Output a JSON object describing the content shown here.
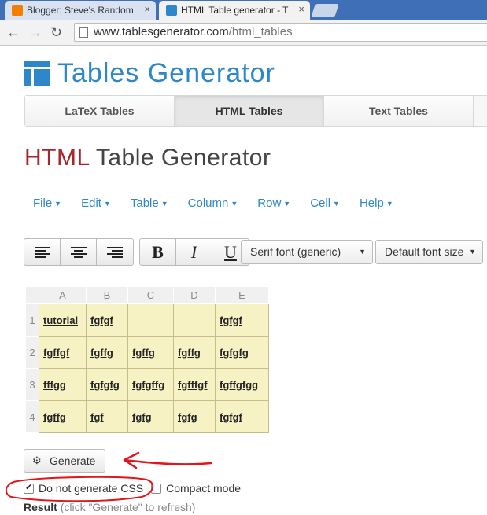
{
  "browser": {
    "tabs": [
      {
        "title": "Blogger: Steve's Random",
        "active": false
      },
      {
        "title": "HTML Table generator - T",
        "active": true
      }
    ],
    "url_host": "www.tablesgenerator.com",
    "url_path": "/html_tables"
  },
  "site": {
    "title": "Tables Generator"
  },
  "nav_tabs": [
    "LaTeX Tables",
    "HTML Tables",
    "Text Tables"
  ],
  "page_title": {
    "prefix": "HTML",
    "rest": " Table Generator"
  },
  "menus": [
    "File",
    "Edit",
    "Table",
    "Column",
    "Row",
    "Cell",
    "Help"
  ],
  "toolbar": {
    "bold": "B",
    "italic": "I",
    "underline": "U",
    "font_select": "Serif font (generic)",
    "size_select": "Default font size"
  },
  "grid": {
    "columns": [
      "A",
      "B",
      "C",
      "D",
      "E"
    ],
    "rows": [
      {
        "label": "1",
        "cells": [
          "tutorial",
          "fgfgf",
          "",
          "",
          "fgfgf"
        ]
      },
      {
        "label": "2",
        "cells": [
          "fgffgf",
          "fgffg",
          "fgffg",
          "fgffg",
          "fgfgfg"
        ]
      },
      {
        "label": "3",
        "cells": [
          "fffgg",
          "fgfgfg",
          "fgfgffg",
          "fgfffgf",
          "fgffgfgg"
        ]
      },
      {
        "label": "4",
        "cells": [
          "fgffg",
          "fgf",
          "fgfg",
          "fgfg",
          "fgfgf"
        ]
      }
    ]
  },
  "generate_label": "Generate",
  "options": {
    "no_css": {
      "label": "Do not generate CSS",
      "checked": true
    },
    "compact": {
      "label": "Compact mode",
      "checked": false
    }
  },
  "result": {
    "label": "Result",
    "hint": "(click \"Generate\" to refresh)"
  },
  "colors": {
    "accent": "#2e87c8",
    "title_red": "#a7262c",
    "cell_bg": "#f6f2c4",
    "annotation": "#e0161c"
  }
}
